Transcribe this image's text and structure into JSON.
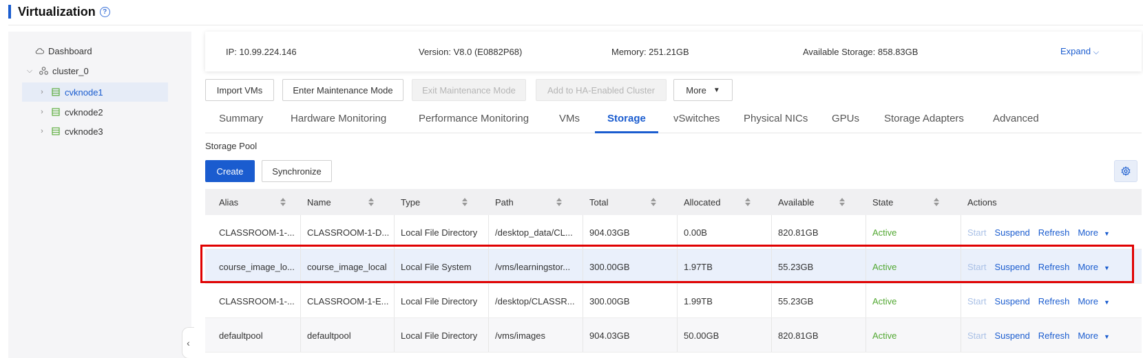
{
  "page": {
    "title": "Virtualization",
    "help_icon": "question-circle-icon"
  },
  "sidebar": {
    "items": [
      {
        "label": "Dashboard",
        "icon": "cloud-icon"
      },
      {
        "label": "cluster_0",
        "icon": "cluster-icon"
      },
      {
        "label": "cvknode1",
        "icon": "server-icon"
      },
      {
        "label": "cvknode2",
        "icon": "server-icon"
      },
      {
        "label": "cvknode3",
        "icon": "server-icon"
      }
    ],
    "collapse_icon": "chevron-left-icon"
  },
  "summary": {
    "ip": "IP: 10.99.224.146",
    "version": "Version: V8.0 (E0882P68)",
    "memory": "Memory: 251.21GB",
    "available_storage": "Available Storage: 858.83GB",
    "expand": "Expand"
  },
  "actions": {
    "import_vms": "Import VMs",
    "enter_maintenance": "Enter Maintenance Mode",
    "exit_maintenance": "Exit Maintenance Mode",
    "add_ha": "Add to HA-Enabled Cluster",
    "more": "More"
  },
  "tabs": [
    "Summary",
    "Hardware Monitoring",
    "Performance Monitoring",
    "VMs",
    "Storage",
    "vSwitches",
    "Physical NICs",
    "GPUs",
    "Storage Adapters",
    "Advanced"
  ],
  "active_tab": "Storage",
  "storage": {
    "section_label": "Storage Pool",
    "create": "Create",
    "synchronize": "Synchronize",
    "columns": [
      "Alias",
      "Name",
      "Type",
      "Path",
      "Total",
      "Allocated",
      "Available",
      "State",
      "Actions"
    ],
    "row_actions": {
      "start": "Start",
      "suspend": "Suspend",
      "refresh": "Refresh",
      "more": "More"
    },
    "rows": [
      {
        "alias": "CLASSROOM-1-...",
        "name": "CLASSROOM-1-D...",
        "type": "Local File Directory",
        "path": "/desktop_data/CL...",
        "total": "904.03GB",
        "allocated": "0.00B",
        "available": "820.81GB",
        "state": "Active"
      },
      {
        "alias": "course_image_lo...",
        "name": "course_image_local",
        "type": "Local File System",
        "path": "/vms/learningstor...",
        "total": "300.00GB",
        "allocated": "1.97TB",
        "available": "55.23GB",
        "state": "Active"
      },
      {
        "alias": "CLASSROOM-1-...",
        "name": "CLASSROOM-1-E...",
        "type": "Local File Directory",
        "path": "/desktop/CLASSR...",
        "total": "300.00GB",
        "allocated": "1.99TB",
        "available": "55.23GB",
        "state": "Active"
      },
      {
        "alias": "defaultpool",
        "name": "defaultpool",
        "type": "Local File Directory",
        "path": "/vms/images",
        "total": "904.03GB",
        "allocated": "50.00GB",
        "available": "820.81GB",
        "state": "Active"
      }
    ]
  },
  "colors": {
    "accent": "#1a5ccf",
    "active_state": "#52a832",
    "highlight": "#e00000"
  }
}
